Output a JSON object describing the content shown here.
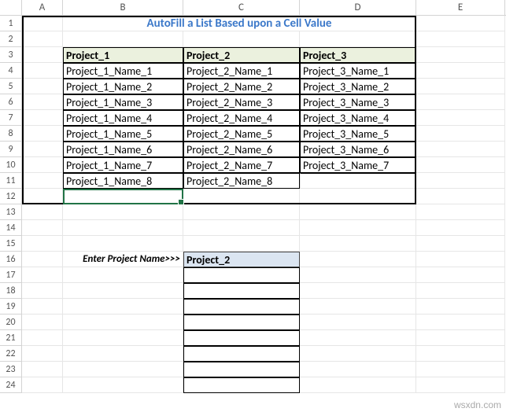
{
  "columns": [
    "A",
    "B",
    "C",
    "D",
    "E"
  ],
  "row_count": 24,
  "title": "AutoFill a List Based upon a Cell Value",
  "headers": {
    "B3": "Project_1",
    "C3": "Project_2",
    "D3": "Project_3"
  },
  "data": {
    "B4": "Project_1_Name_1",
    "B5": "Project_1_Name_2",
    "B6": "Project_1_Name_3",
    "B7": "Project_1_Name_4",
    "B8": "Project_1_Name_5",
    "B9": "Project_1_Name_6",
    "B10": "Project_1_Name_7",
    "B11": "Project_1_Name_8",
    "C4": "Project_2_Name_1",
    "C5": "Project_2_Name_2",
    "C6": "Project_2_Name_3",
    "C7": "Project_2_Name_4",
    "C8": "Project_2_Name_5",
    "C9": "Project_2_Name_6",
    "C10": "Project_2_Name_7",
    "C11": "Project_2_Name_8",
    "D4": "Project_3_Name_1",
    "D5": "Project_3_Name_2",
    "D6": "Project_3_Name_3",
    "D7": "Project_3_Name_4",
    "D8": "Project_3_Name_5",
    "D9": "Project_3_Name_6",
    "D10": "Project_3_Name_7"
  },
  "prompt_label": "Enter Project Name>>>",
  "input_value": "Project_2",
  "watermark": "wsxdn.com",
  "frame_range": {
    "top_row": 1,
    "bottom_row": 12,
    "left_col": "A",
    "right_col": "D"
  },
  "output_range_rows": [
    17,
    18,
    19,
    20,
    21,
    22,
    23,
    24
  ],
  "selected_cell": "B12"
}
